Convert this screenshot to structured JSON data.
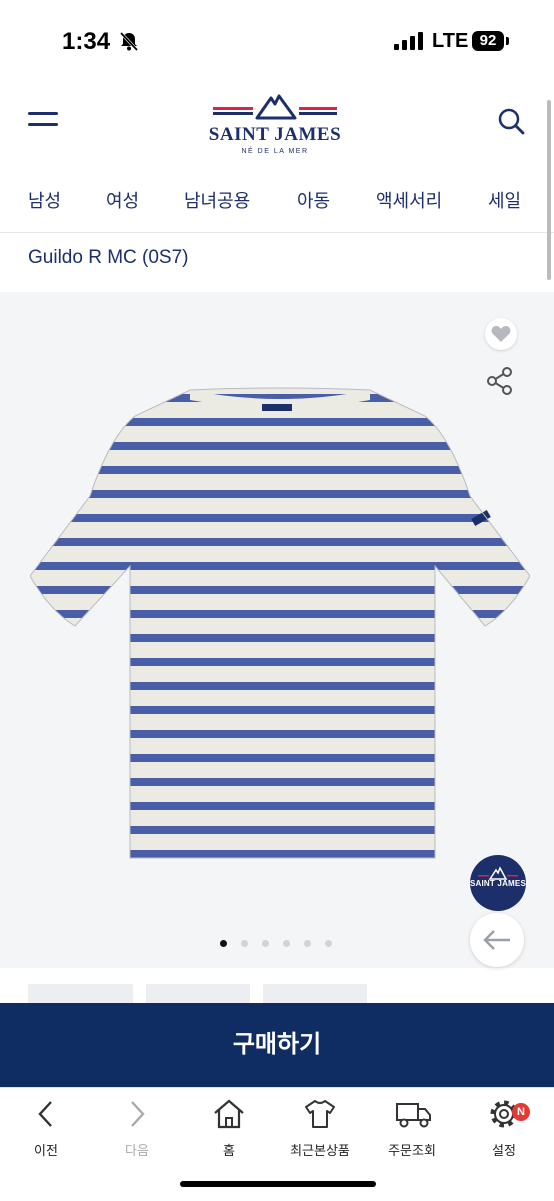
{
  "status_bar": {
    "time": "1:34",
    "network": "LTE",
    "battery": "92"
  },
  "header": {
    "brand_name": "SAINT JAMES",
    "brand_tagline": "NÉ DE LA MER",
    "menu_icon": "hamburger-icon",
    "search_icon": "search-icon"
  },
  "nav": {
    "items": [
      "남성",
      "여성",
      "남녀공용",
      "아동",
      "액세서리",
      "세일"
    ]
  },
  "product": {
    "breadcrumb": "Guildo R MC (0S7)"
  },
  "gallery": {
    "slide_count": 6,
    "active_slide": 1,
    "badge_text": "SAINT JAMES"
  },
  "buy_button": {
    "label": "구매하기"
  },
  "bottom_nav": {
    "items": [
      {
        "label": "이전",
        "icon": "chevron-left-icon"
      },
      {
        "label": "다음",
        "icon": "chevron-right-icon"
      },
      {
        "label": "홈",
        "icon": "home-icon"
      },
      {
        "label": "최근본상품",
        "icon": "tshirt-icon"
      },
      {
        "label": "주문조회",
        "icon": "truck-icon"
      },
      {
        "label": "설정",
        "icon": "gear-icon"
      }
    ],
    "settings_badge": "N"
  },
  "colors": {
    "brand_navy": "#0f2d63",
    "stripe_blue": "#4a5ea8",
    "stripe_cream": "#ecebe3",
    "accent_red": "#d7263d"
  }
}
